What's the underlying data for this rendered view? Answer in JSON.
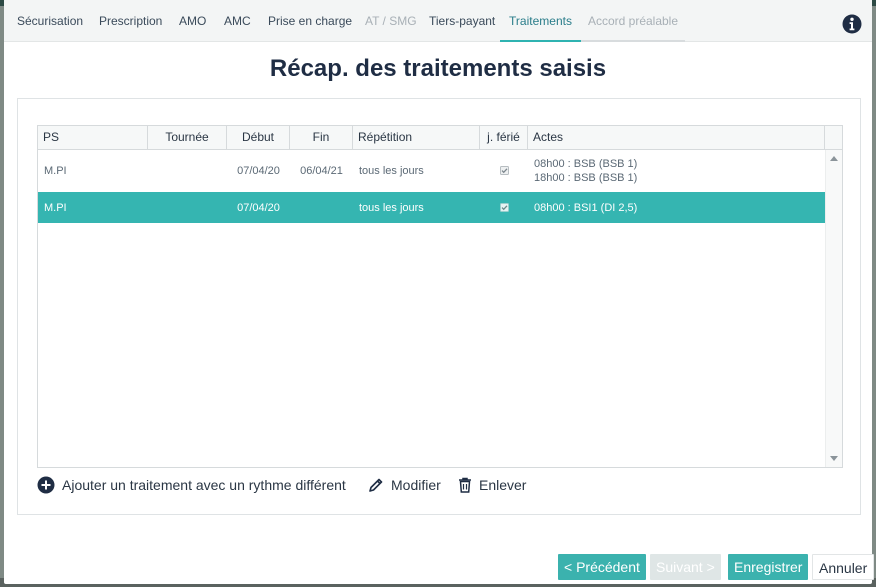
{
  "tabs": [
    {
      "label": "Sécurisation",
      "state": "normal"
    },
    {
      "label": "Prescription",
      "state": "normal"
    },
    {
      "label": "AMO",
      "state": "normal"
    },
    {
      "label": "AMC",
      "state": "normal"
    },
    {
      "label": "Prise en charge",
      "state": "normal"
    },
    {
      "label": "AT / SMG",
      "state": "disabled"
    },
    {
      "label": "Tiers-payant",
      "state": "normal"
    },
    {
      "label": "Traitements",
      "state": "active"
    },
    {
      "label": "Accord préalable",
      "state": "disabled"
    }
  ],
  "title": "Récap. des traitements saisis",
  "table": {
    "columns": [
      "PS",
      "Tournée",
      "Début",
      "Fin",
      "Répétition",
      "j. férié",
      "Actes"
    ],
    "rows": [
      {
        "ps": "M.PI",
        "tournee": "",
        "debut": "07/04/20",
        "fin": "06/04/21",
        "repetition": "tous les jours",
        "ferie_checked": true,
        "actes": [
          "08h00 : BSB (BSB 1)",
          "18h00 : BSB (BSB 1)"
        ],
        "selected": false
      },
      {
        "ps": "M.PI",
        "tournee": "",
        "debut": "07/04/20",
        "fin": "",
        "repetition": "tous les jours",
        "ferie_checked": true,
        "actes": [
          "08h00 : BSI1 (DI 2,5)"
        ],
        "selected": true
      }
    ]
  },
  "actions": {
    "add_label": "Ajouter un traitement avec un rythme différent",
    "modify_label": "Modifier",
    "remove_label": "Enlever"
  },
  "footer": {
    "prev_label": "< Précédent",
    "next_label": "Suivant >",
    "save_label": "Enregistrer",
    "cancel_label": "Annuler"
  },
  "colors": {
    "accent": "#35b5b1",
    "title": "#1f2d44",
    "tab_text": "#3a4a5a"
  },
  "icons": {
    "info": "info-circle-icon",
    "add": "plus-circle-icon",
    "modify": "pencil-icon",
    "remove": "trash-icon"
  }
}
